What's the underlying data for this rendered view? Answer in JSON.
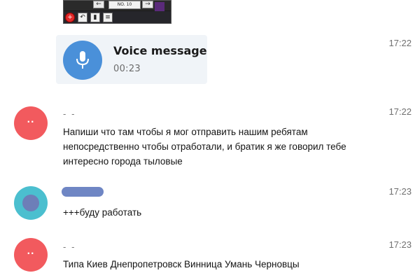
{
  "attachment": {
    "no_label": "NO. 10",
    "tool_icons": [
      "plus-icon",
      "undo-icon",
      "trash-icon",
      "list-icon"
    ]
  },
  "voice_message": {
    "title": "Voice message",
    "duration": "00:23",
    "time": "17:22",
    "accent_color": "#4a90d9"
  },
  "messages": [
    {
      "sender": "- -",
      "avatar_initials": "..",
      "avatar_color": "#f25a5e",
      "time": "17:22",
      "lines": [
        "Напиши что там чтобы я мог отправить нашим ребятам",
        "непосредственно чтобы отработали, и братик я же говорил тебе",
        "интересно города тыловые"
      ]
    },
    {
      "sender": "",
      "avatar_color": "#4bbfcf",
      "time": "17:23",
      "lines": [
        "+++буду работать"
      ]
    },
    {
      "sender": "- -",
      "avatar_initials": "..",
      "avatar_color": "#f25a5e",
      "time": "17:23",
      "lines": [
        "Типа Киев Днепропетровск Винница Умань Черновцы"
      ]
    }
  ]
}
